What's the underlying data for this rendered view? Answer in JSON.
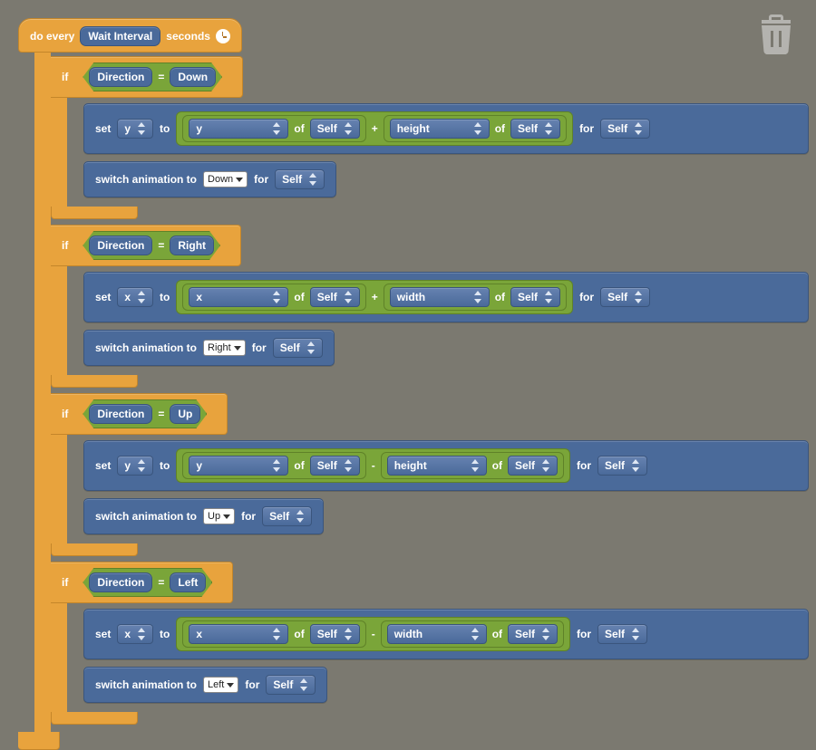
{
  "trash": {
    "name": "trash"
  },
  "hat": {
    "prefix": "do every",
    "param": "Wait Interval",
    "suffix": "seconds"
  },
  "common": {
    "if": "if",
    "set": "set",
    "to": "to",
    "of": "of",
    "for": "for",
    "self": "Self",
    "switch": "switch animation to",
    "eq": "=",
    "direction": "Direction"
  },
  "branches": [
    {
      "dir": "Down",
      "axis": "y",
      "dim": "height",
      "op": "+",
      "anim": "Down"
    },
    {
      "dir": "Right",
      "axis": "x",
      "dim": "width",
      "op": "+",
      "anim": "Right"
    },
    {
      "dir": "Up",
      "axis": "y",
      "dim": "height",
      "op": "-",
      "anim": "Up"
    },
    {
      "dir": "Left",
      "axis": "x",
      "dim": "width",
      "op": "-",
      "anim": "Left"
    }
  ]
}
